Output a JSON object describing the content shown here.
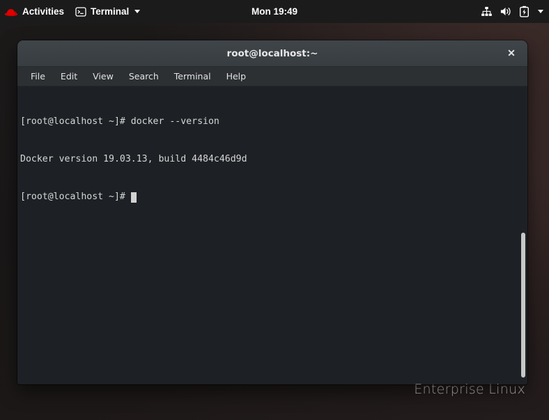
{
  "topbar": {
    "activities_label": "Activities",
    "app_menu_label": "Terminal",
    "app_menu_icon": "terminal-icon",
    "logo_icon": "red-hat-logo-icon",
    "clock": "Mon 19:49",
    "status_icons": [
      "network-wired-icon",
      "volume-up-icon",
      "battery-charging-icon",
      "chevron-down-icon"
    ],
    "background_color": "#1b1b1b",
    "text_color": "#ffffff",
    "logo_color": "#cc0000"
  },
  "desktop": {
    "wallpaper_text": "Enterprise Linux",
    "wallpaper_color": "#1d1a1a"
  },
  "window": {
    "title": "root@localhost:~",
    "close_label": "✕",
    "close_icon": "close-icon",
    "titlebar_color": "#3f4548",
    "menubar": [
      {
        "label": "File"
      },
      {
        "label": "Edit"
      },
      {
        "label": "View"
      },
      {
        "label": "Search"
      },
      {
        "label": "Terminal"
      },
      {
        "label": "Help"
      }
    ]
  },
  "terminal": {
    "background_color": "#1d2125",
    "text_color": "#d6d6d6",
    "lines": [
      "[root@localhost ~]# docker --version",
      "Docker version 19.03.13, build 4484c46d9d"
    ],
    "prompt": "[root@localhost ~]# ",
    "cursor": "block-cursor",
    "scrollbar": "vertical-scrollbar"
  }
}
